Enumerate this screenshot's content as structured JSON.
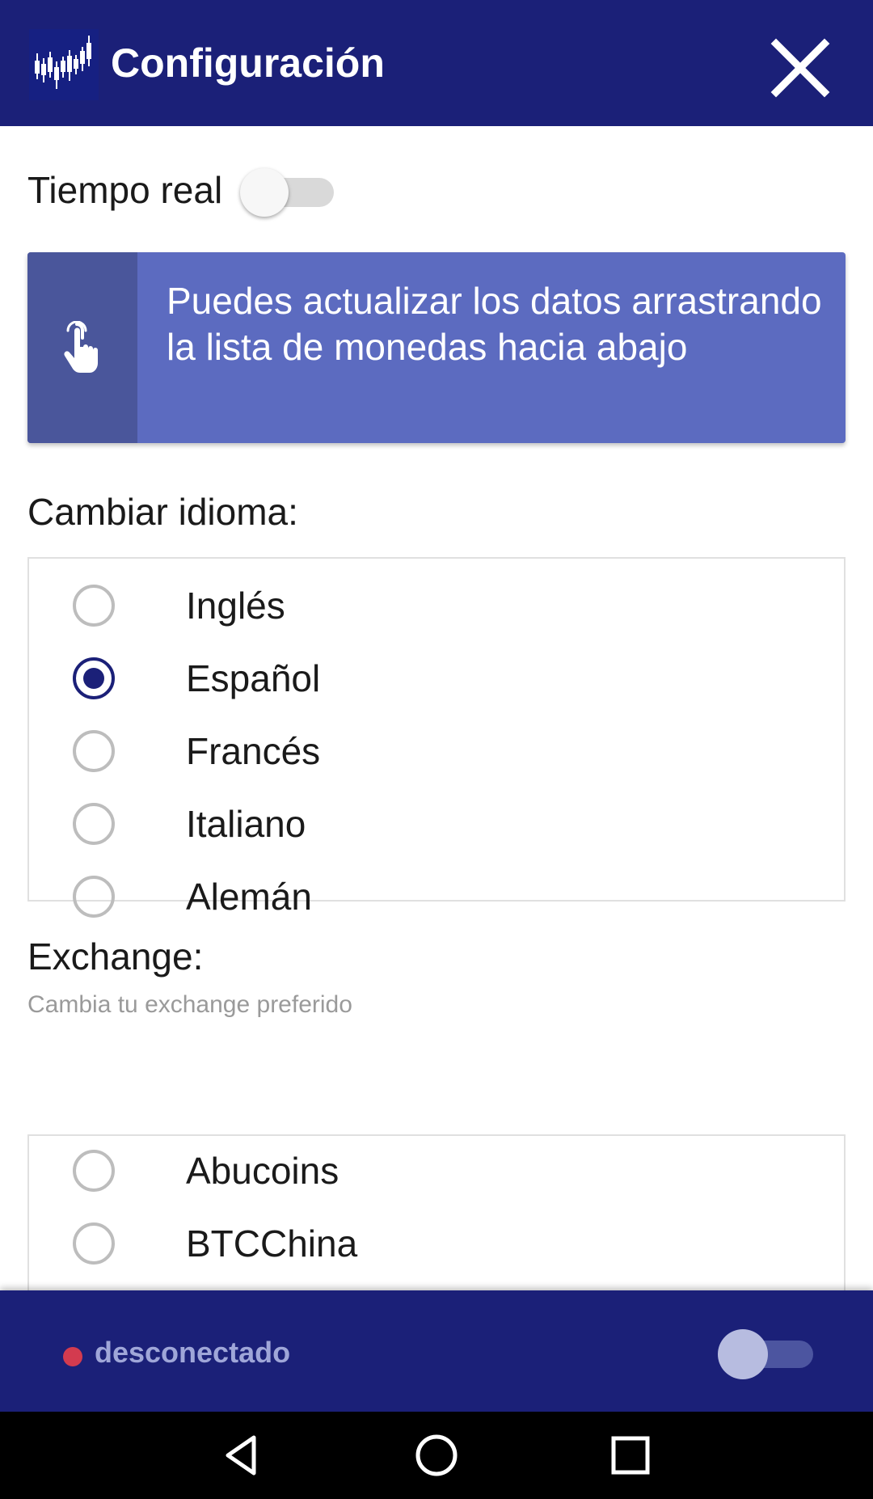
{
  "app_bar": {
    "title": "Configuración",
    "logo_icon": "candlestick-chart-logo-icon",
    "close_icon": "close-icon"
  },
  "settings": {
    "realtime_label": "Tiempo real",
    "realtime_enabled": false,
    "tip": {
      "icon": "tap-hand-icon",
      "text": "Puedes actualizar los datos arrastrando la lista de monedas hacia abajo"
    },
    "language": {
      "label": "Cambiar idioma:",
      "options": [
        "Inglés",
        "Español",
        "Francés",
        "Italiano",
        "Alemán"
      ],
      "selected": "Español"
    },
    "exchange": {
      "label": "Exchange:",
      "subtitle": "Cambia tu exchange preferido",
      "options": [
        "Abucoins",
        "BTCChina"
      ],
      "selected": null
    }
  },
  "bottom_bar": {
    "status": "desconectado",
    "status_color": "#d33b4f",
    "connection_enabled": false
  },
  "nav": {
    "back_icon": "back-triangle-icon",
    "home_icon": "home-circle-icon",
    "recents_icon": "recents-square-icon"
  },
  "colors": {
    "primary": "#1b2078",
    "tip_background": "#5c6bc0",
    "tip_icon_background": "#4a569b"
  }
}
